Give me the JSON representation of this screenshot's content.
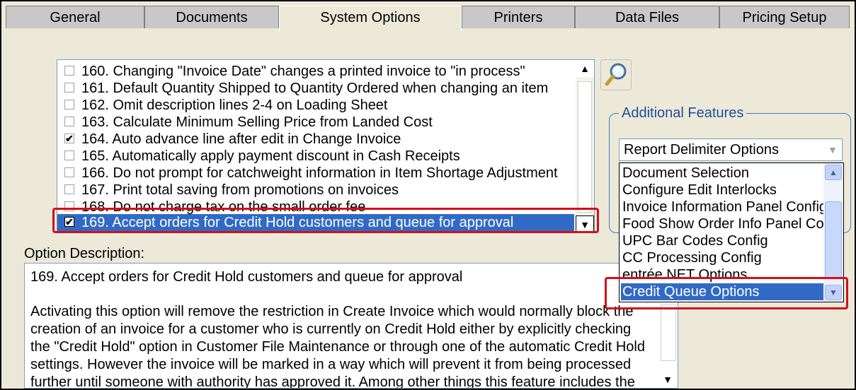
{
  "tabs": [
    {
      "label": "General",
      "active": false
    },
    {
      "label": "Documents",
      "active": false
    },
    {
      "label": "System Options",
      "active": true
    },
    {
      "label": "Printers",
      "active": false
    },
    {
      "label": "Data Files",
      "active": false
    },
    {
      "label": "Pricing Setup",
      "active": false
    }
  ],
  "options": [
    {
      "label": "160. Changing \"Invoice Date\" changes a printed invoice to \"in process\"",
      "checked": false
    },
    {
      "label": "161. Default Quantity Shipped to Quantity Ordered when changing an item",
      "checked": false
    },
    {
      "label": "162. Omit description lines 2-4 on Loading Sheet",
      "checked": false
    },
    {
      "label": "163. Calculate Minimum Selling Price from Landed Cost",
      "checked": false
    },
    {
      "label": "164. Auto advance line after edit in Change Invoice",
      "checked": true
    },
    {
      "label": "165. Automatically apply payment discount in Cash Receipts",
      "checked": false
    },
    {
      "label": "166. Do not prompt for catchweight information in Item Shortage Adjustment",
      "checked": false
    },
    {
      "label": "167. Print total saving from promotions on invoices",
      "checked": false
    },
    {
      "label": "168. Do not charge tax on the small order fee",
      "checked": false
    },
    {
      "label": "169. Accept orders for Credit Hold customers and queue for approval",
      "checked": true,
      "selected": true
    }
  ],
  "description": {
    "label": "Option Description:",
    "title": "169. Accept orders for Credit Hold customers and queue for approval",
    "body": "Activating this option will remove the restriction in Create Invoice which would normally block the creation of an invoice for a customer who is currently on Credit Hold either by explicitly checking the \"Credit Hold\" option in Customer File Maintenance or through one of the automatic Credit Hold settings. However the invoice will be marked in a way which will prevent it from being processed further until someone with authority has approved it. Among other things this feature includes the"
  },
  "features": {
    "group_label": "Additional Features",
    "selected_value": "Report Delimiter Options",
    "dropdown_items": [
      {
        "label": "Document Selection",
        "selected": false
      },
      {
        "label": "Configure Edit Interlocks",
        "selected": false
      },
      {
        "label": "Invoice Information Panel Config",
        "selected": false
      },
      {
        "label": "Food Show Order Info Panel Config",
        "selected": false
      },
      {
        "label": "UPC Bar Codes Config",
        "selected": false
      },
      {
        "label": "CC Processing Config",
        "selected": false
      },
      {
        "label": "entrée.NET Options",
        "selected": false
      },
      {
        "label": "Credit Queue Options",
        "selected": true
      }
    ]
  },
  "icons": {
    "check": "✔",
    "up": "▲",
    "down": "▼",
    "magnifier": "magnifier-icon"
  },
  "colors": {
    "selection": "#316ac5",
    "highlight": "#d0101a",
    "group_border": "#3c7bc7"
  }
}
